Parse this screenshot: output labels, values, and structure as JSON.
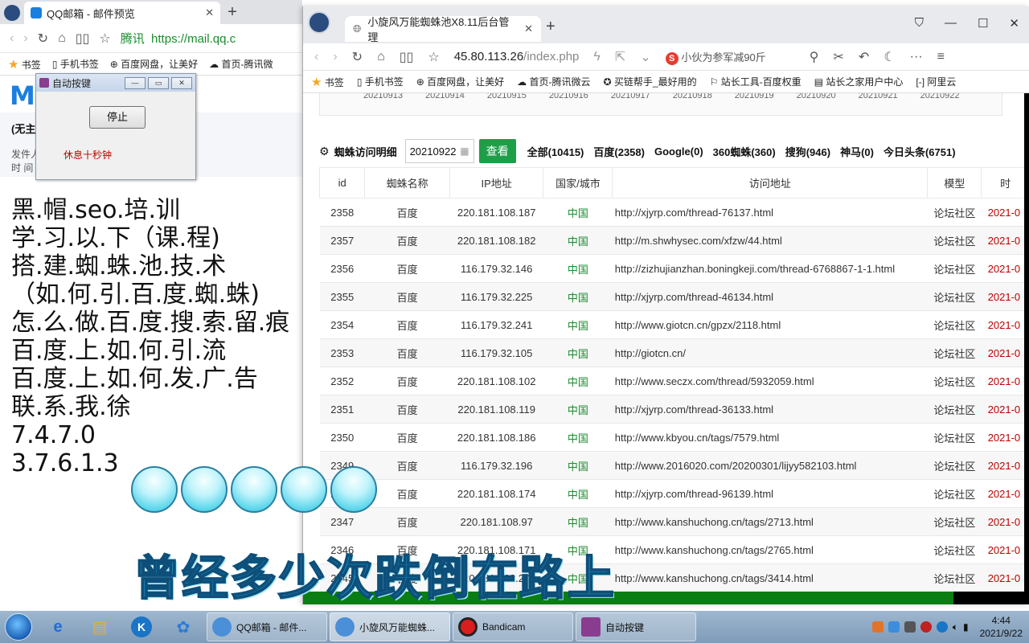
{
  "left_browser": {
    "tab_title": "QQ邮箱 - 邮件预览",
    "url_prefix": "腾讯",
    "url": "https://mail.qq.c",
    "bookmarks": [
      "书签",
      "手机书签",
      "百度网盘，让美好",
      "首页-腾讯微"
    ],
    "mail_subject": "(无主",
    "mail_from": "发件人",
    "mail_time": "时  间"
  },
  "dialog": {
    "title": "自动按键",
    "stop_label": "停止",
    "status": "休息十秒钟"
  },
  "big_text": [
    "黑.帽.seo.培.训",
    "学.习.以.下（课.程)",
    "搭.建.蜘.蛛.池.技.术",
    "（如.何.引.百.度.蜘.蛛)",
    "怎.么.做.百.度.搜.索.留.痕",
    "百.度.上.如.何.引.流",
    "百.度.上.如.何.发.广.告",
    "联.系.我.徐",
    "7.4.7.0",
    "3.7.6.1.3"
  ],
  "right_browser": {
    "tab_title": "小旋风万能蜘蛛池X8.11后台管理",
    "url_host": "45.80.113.26",
    "url_path": "/index.php",
    "search_hint": "小伙为参军减90斤",
    "bookmarks": [
      "书签",
      "手机书签",
      "百度网盘，让美好",
      "首页-腾讯微云",
      "买链帮手_最好用的",
      "站长工具-百度权重",
      "站长之家用户中心",
      "阿里云"
    ],
    "date_strip": [
      "20210913",
      "20210914",
      "20210915",
      "20210916",
      "20210917",
      "20210918",
      "20210919",
      "20210920",
      "20210921",
      "20210922"
    ]
  },
  "filter": {
    "title": "蜘蛛访问明细",
    "date": "20210922",
    "view_label": "查看",
    "stats": [
      "全部(10415)",
      "百度(2358)",
      "Google(0)",
      "360蜘蛛(360)",
      "搜狗(946)",
      "神马(0)",
      "今日头条(6751)"
    ]
  },
  "table": {
    "headers": [
      "id",
      "蜘蛛名称",
      "IP地址",
      "国家/城市",
      "访问地址",
      "模型",
      "时"
    ],
    "rows": [
      [
        "2358",
        "百度",
        "220.181.108.187",
        "中国",
        "http://xjyrp.com/thread-76137.html",
        "论坛社区",
        "2021-0"
      ],
      [
        "2357",
        "百度",
        "220.181.108.182",
        "中国",
        "http://m.shwhysec.com/xfzw/44.html",
        "论坛社区",
        "2021-0"
      ],
      [
        "2356",
        "百度",
        "116.179.32.146",
        "中国",
        "http://zizhujianzhan.boningkeji.com/thread-6768867-1-1.html",
        "论坛社区",
        "2021-0"
      ],
      [
        "2355",
        "百度",
        "116.179.32.225",
        "中国",
        "http://xjyrp.com/thread-46134.html",
        "论坛社区",
        "2021-0"
      ],
      [
        "2354",
        "百度",
        "116.179.32.241",
        "中国",
        "http://www.giotcn.cn/gpzx/2118.html",
        "论坛社区",
        "2021-0"
      ],
      [
        "2353",
        "百度",
        "116.179.32.105",
        "中国",
        "http://giotcn.cn/",
        "论坛社区",
        "2021-0"
      ],
      [
        "2352",
        "百度",
        "220.181.108.102",
        "中国",
        "http://www.seczx.com/thread/5932059.html",
        "论坛社区",
        "2021-0"
      ],
      [
        "2351",
        "百度",
        "220.181.108.119",
        "中国",
        "http://xjyrp.com/thread-36133.html",
        "论坛社区",
        "2021-0"
      ],
      [
        "2350",
        "百度",
        "220.181.108.186",
        "中国",
        "http://www.kbyou.cn/tags/7579.html",
        "论坛社区",
        "2021-0"
      ],
      [
        "2349",
        "百度",
        "116.179.32.196",
        "中国",
        "http://www.2016020.com/20200301/lijyy582103.html",
        "论坛社区",
        "2021-0"
      ],
      [
        "2348",
        "百度",
        "220.181.108.174",
        "中国",
        "http://xjyrp.com/thread-96139.html",
        "论坛社区",
        "2021-0"
      ],
      [
        "2347",
        "百度",
        "220.181.108.97",
        "中国",
        "http://www.kanshuchong.cn/tags/2713.html",
        "论坛社区",
        "2021-0"
      ],
      [
        "2346",
        "百度",
        "220.181.108.171",
        "中国",
        "http://www.kanshuchong.cn/tags/2765.html",
        "论坛社区",
        "2021-0"
      ],
      [
        "2345",
        "百度",
        "220.181.108.209",
        "中国",
        "http://www.kanshuchong.cn/tags/3414.html",
        "论坛社区",
        "2021-0"
      ]
    ]
  },
  "progress": {
    "fraction": 0.895,
    "color": "#0a7e12"
  },
  "caption": "曾经多少次跌倒在路上",
  "taskbar": {
    "tasks": [
      "QQ邮箱 - 邮件...",
      "小旋风万能蜘蛛...",
      "Bandicam",
      "自动按键"
    ],
    "time": "4:44",
    "date": "2021/9/22"
  }
}
